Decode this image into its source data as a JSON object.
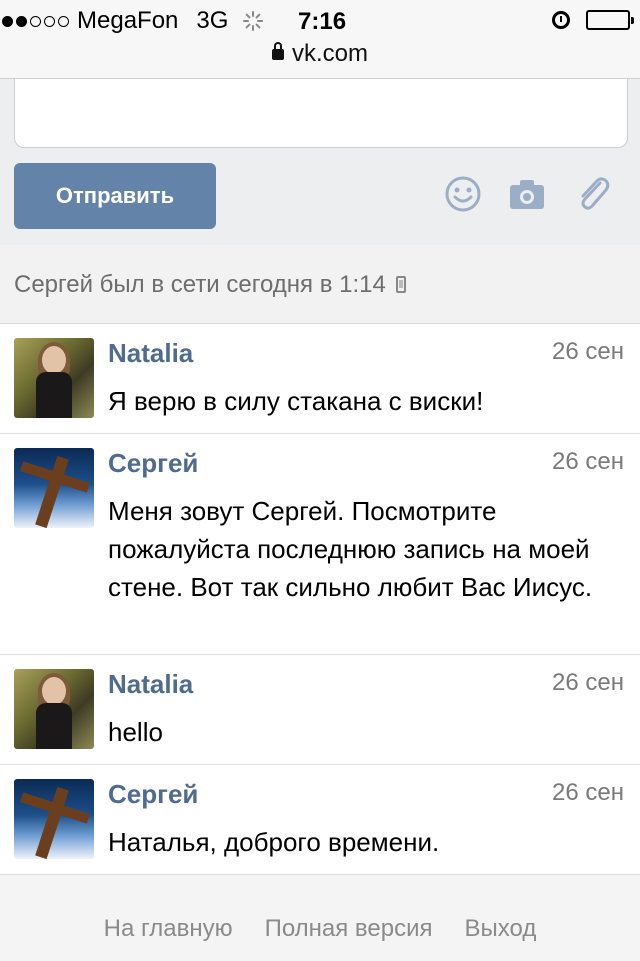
{
  "status_bar": {
    "carrier": "MegaFon",
    "network": "3G",
    "time": "7:16",
    "url": "vk.com",
    "signal_bars_filled": 2,
    "signal_bars_total": 5
  },
  "compose": {
    "send_label": "Отправить",
    "icons": [
      "smile-icon",
      "camera-icon",
      "paperclip-icon"
    ]
  },
  "online_status": "Сергей был в сети сегодня в 1:14",
  "messages": [
    {
      "author": "Natalia",
      "date": "26 сен",
      "text": "Я верю в силу стакана с виски!"
    },
    {
      "author": "Сергей",
      "date": "26 сен",
      "text": "Меня зовут Сергей. Посмотрите пожалуйста последнюю запись на моей стене. Вот так сильно любит Вас Иисус."
    },
    {
      "author": "Natalia",
      "date": "26 сен",
      "text": "hello"
    },
    {
      "author": "Сергей",
      "date": "26 сен",
      "text": "Наталья, доброго времени."
    }
  ],
  "footer": {
    "home": "На главную",
    "full_version": "Полная версия",
    "logout": "Выход"
  },
  "colors": {
    "accent": "#6383a8",
    "name": "#4f6b8f"
  }
}
